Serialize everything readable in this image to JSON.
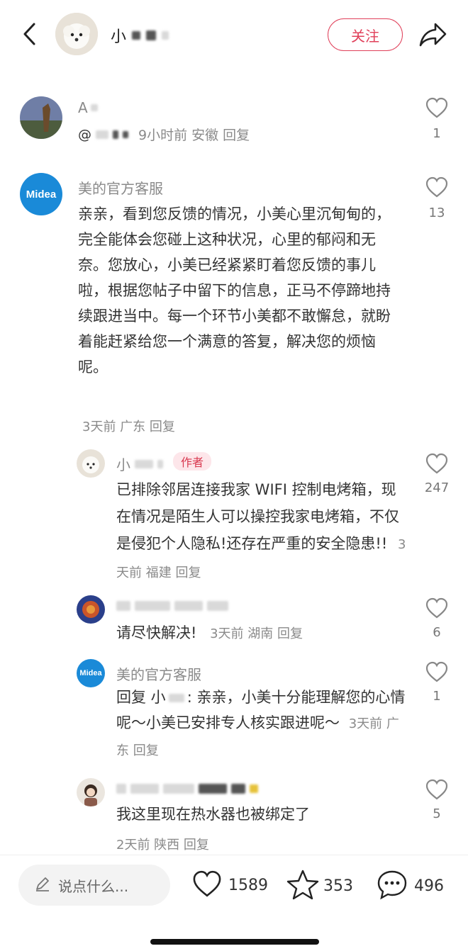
{
  "header": {
    "user_name": "小",
    "follow_label": "关注"
  },
  "comments": [
    {
      "name": "A",
      "body_prefix": "@",
      "meta": "9小时前 安徽 回复",
      "likes": "1"
    },
    {
      "name": "美的官方客服",
      "body": "亲亲，看到您反馈的情况，小美心里沉甸甸的，完全能体会您碰上这种状况，心里的郁闷和无奈。您放心，小美已经紧紧盯着您反馈的事儿啦，根据您帖子中留下的信息，正马不停蹄地持续跟进当中。每一个环节小美都不敢懈怠，就盼着能赶紧给您一个满意的答复，解决您的烦恼呢。",
      "meta": "3天前 广东 回复",
      "likes": "13",
      "avatar_text": "Midea"
    }
  ],
  "replies": [
    {
      "name": "小",
      "badge": "作者",
      "body": "已排除邻居连接我家 WIFI 控制电烤箱，现在情况是陌生人可以操控我家电烤箱，不仅是侵犯个人隐私!还存在严重的安全隐患!!",
      "meta": "3天前 福建 回复",
      "likes": "247"
    },
    {
      "name": "",
      "body": "请尽快解决!",
      "meta": "3天前 湖南 回复",
      "likes": "6"
    },
    {
      "name": "美的官方客服",
      "body_prefix": "回复 小",
      "body": ": 亲亲，小美十分能理解您的心情呢～小美已安排专人核实跟进呢～",
      "meta": "3天前 广东 回复",
      "likes": "1",
      "avatar_text": "Midea"
    },
    {
      "name": "",
      "body": "我这里现在热水器也被绑定了",
      "meta": "2天前 陕西 回复",
      "likes": "5"
    }
  ],
  "bottom_bar": {
    "input_placeholder": "说点什么...",
    "likes": "1589",
    "favorites": "353",
    "comments": "496"
  }
}
